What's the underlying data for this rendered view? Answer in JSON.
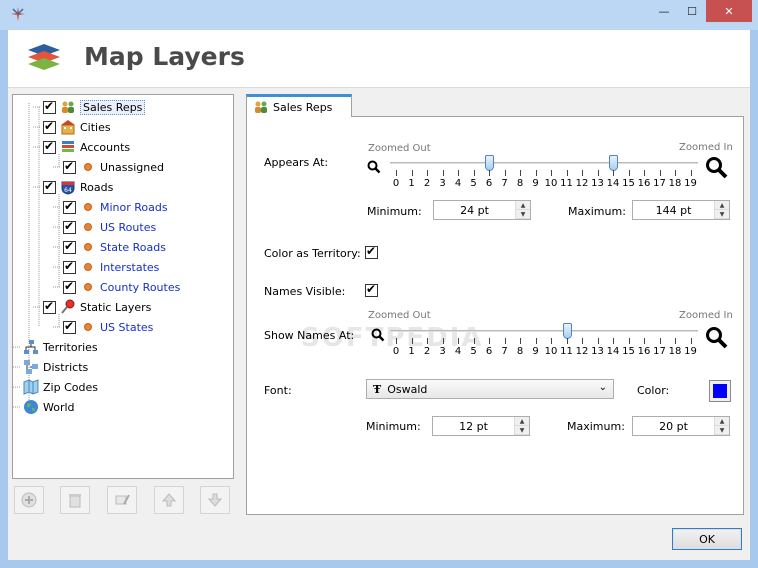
{
  "window": {
    "minimize": "—",
    "maximize": "☐",
    "close": "✕"
  },
  "header": {
    "title": "Map Layers"
  },
  "tree": [
    {
      "label": "Sales Reps",
      "color": "black",
      "icon": "people-icon",
      "checked": true
    },
    {
      "label": "Cities",
      "color": "black",
      "icon": "building-icon",
      "checked": true
    },
    {
      "label": "Accounts",
      "color": "black",
      "icon": "stack-icon",
      "checked": true
    },
    {
      "label": "Unassigned",
      "color": "black",
      "icon": "dot-icon",
      "checked": true
    },
    {
      "label": "Roads",
      "color": "black",
      "icon": "road-shield-icon",
      "checked": true
    },
    {
      "label": "Minor Roads",
      "color": "blue",
      "icon": "dot-icon",
      "checked": true
    },
    {
      "label": "US Routes",
      "color": "blue",
      "icon": "dot-icon",
      "checked": true
    },
    {
      "label": "State Roads",
      "color": "blue",
      "icon": "dot-icon",
      "checked": true
    },
    {
      "label": "Interstates",
      "color": "blue",
      "icon": "dot-icon",
      "checked": true
    },
    {
      "label": "County Routes",
      "color": "blue",
      "icon": "dot-icon",
      "checked": true
    },
    {
      "label": "Static Layers",
      "color": "black",
      "icon": "pushpin-icon",
      "checked": true
    },
    {
      "label": "US States",
      "color": "blue",
      "icon": "dot-icon",
      "checked": true
    },
    {
      "label": "Territories",
      "color": "black",
      "icon": "hierarchy-icon",
      "checked": false
    },
    {
      "label": "Districts",
      "color": "black",
      "icon": "districts-icon",
      "checked": false
    },
    {
      "label": "Zip Codes",
      "color": "black",
      "icon": "zip-map-icon",
      "checked": false
    },
    {
      "label": "World",
      "color": "black",
      "icon": "globe-icon",
      "checked": false
    }
  ],
  "toolbar_buttons": [
    "add-icon",
    "delete-icon",
    "edit-icon",
    "move-up-icon",
    "move-down-icon"
  ],
  "tab": {
    "label": "Sales Reps"
  },
  "appears_at": {
    "label": "Appears At:",
    "zoomed_out": "Zoomed Out",
    "zoomed_in": "Zoomed In",
    "ticks": [
      "0",
      "1",
      "2",
      "3",
      "4",
      "5",
      "6",
      "7",
      "8",
      "9",
      "10",
      "11",
      "12",
      "13",
      "14",
      "15",
      "16",
      "17",
      "18",
      "19"
    ],
    "low": 6,
    "high": 14,
    "min_label": "Minimum:",
    "min_value": "24 pt",
    "max_label": "Maximum:",
    "max_value": "144 pt"
  },
  "color_territory": {
    "label": "Color as Territory:",
    "checked": true
  },
  "names_visible": {
    "label": "Names Visible:",
    "checked": true
  },
  "show_names": {
    "label": "Show Names At:",
    "zoomed_out": "Zoomed Out",
    "zoomed_in": "Zoomed In",
    "ticks": [
      "0",
      "1",
      "2",
      "3",
      "4",
      "5",
      "6",
      "7",
      "8",
      "9",
      "10",
      "11",
      "12",
      "13",
      "14",
      "15",
      "16",
      "17",
      "18",
      "19"
    ],
    "value": 11
  },
  "font": {
    "label": "Font:",
    "value": "Oswald",
    "color_label": "Color:",
    "color": "#0000ff"
  },
  "font_size": {
    "min_label": "Minimum:",
    "min_value": "12 pt",
    "max_label": "Maximum:",
    "max_value": "20 pt"
  },
  "ok_label": "OK",
  "watermark": "SOFTPEDIA"
}
